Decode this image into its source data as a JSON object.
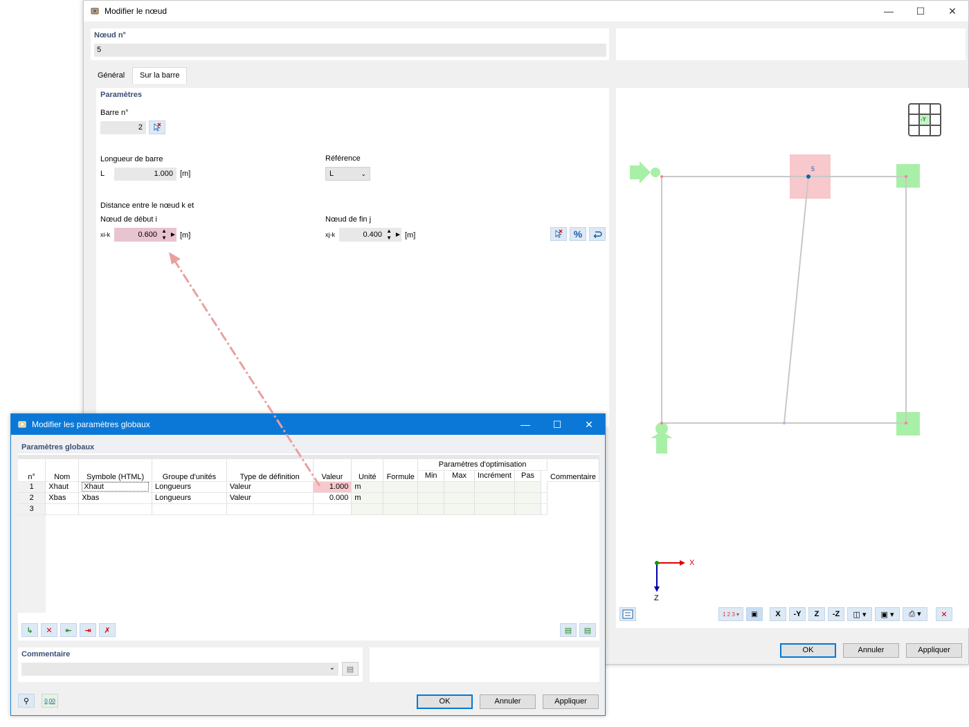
{
  "node_dialog": {
    "title": "Modifier le nœud",
    "node_no_label": "Nœud n°",
    "node_no_value": "5",
    "tabs": [
      {
        "label": "Général"
      },
      {
        "label": "Sur la barre"
      }
    ],
    "params_header": "Paramètres",
    "member_no_label": "Barre n°",
    "member_no_value": "2",
    "length_label": "Longueur de barre",
    "length_symbol": "L",
    "length_value": "1.000",
    "length_unit": "[m]",
    "reference_label": "Référence",
    "reference_value": "L",
    "distance_label": "Distance entre le nœud k et",
    "start_label": "Nœud de début i",
    "start_symbol": "xi-k",
    "start_value": "0.600",
    "start_unit": "[m]",
    "end_label": "Nœud de fin j",
    "end_symbol": "xj-k",
    "end_value": "0.400",
    "end_unit": "[m]",
    "percent_label": "%",
    "view_node_label": "5",
    "view_axis_badge": "-Y",
    "axis_x": "X",
    "axis_z": "Z",
    "ok": "OK",
    "cancel": "Annuler",
    "apply": "Appliquer"
  },
  "global_dialog": {
    "title": "Modifier les paramètres globaux",
    "section_header": "Paramètres globaux",
    "columns": {
      "no": "n°",
      "name": "Nom",
      "symbol": "Symbole (HTML)",
      "unit_group": "Groupe d'unités",
      "def_type": "Type de définition",
      "value": "Valeur",
      "unit": "Unité",
      "formula": "Formule",
      "opt_group": "Paramètres d'optimisation",
      "min": "Min",
      "max": "Max",
      "increment": "Incrément",
      "step": "Pas",
      "comment": "Commentaire"
    },
    "rows": [
      {
        "no": "1",
        "name": "Xhaut",
        "symbol": "Xhaut",
        "unit_group": "Longueurs",
        "def_type": "Valeur",
        "value": "1.000",
        "unit": "m"
      },
      {
        "no": "2",
        "name": "Xbas",
        "symbol": "Xbas",
        "unit_group": "Longueurs",
        "def_type": "Valeur",
        "value": "0.000",
        "unit": "m"
      },
      {
        "no": "3",
        "name": "",
        "symbol": "",
        "unit_group": "",
        "def_type": "",
        "value": "",
        "unit": ""
      }
    ],
    "comment_header": "Commentaire",
    "decimal_badge": "0,00",
    "ok": "OK",
    "cancel": "Annuler",
    "apply": "Appliquer"
  },
  "colors": {
    "accent": "#0078d7",
    "highlight_field": "#e8c4d0",
    "support_green": "#9ef09e",
    "node_pink": "#f7c8cc",
    "arrow": "#e8a0a0"
  }
}
